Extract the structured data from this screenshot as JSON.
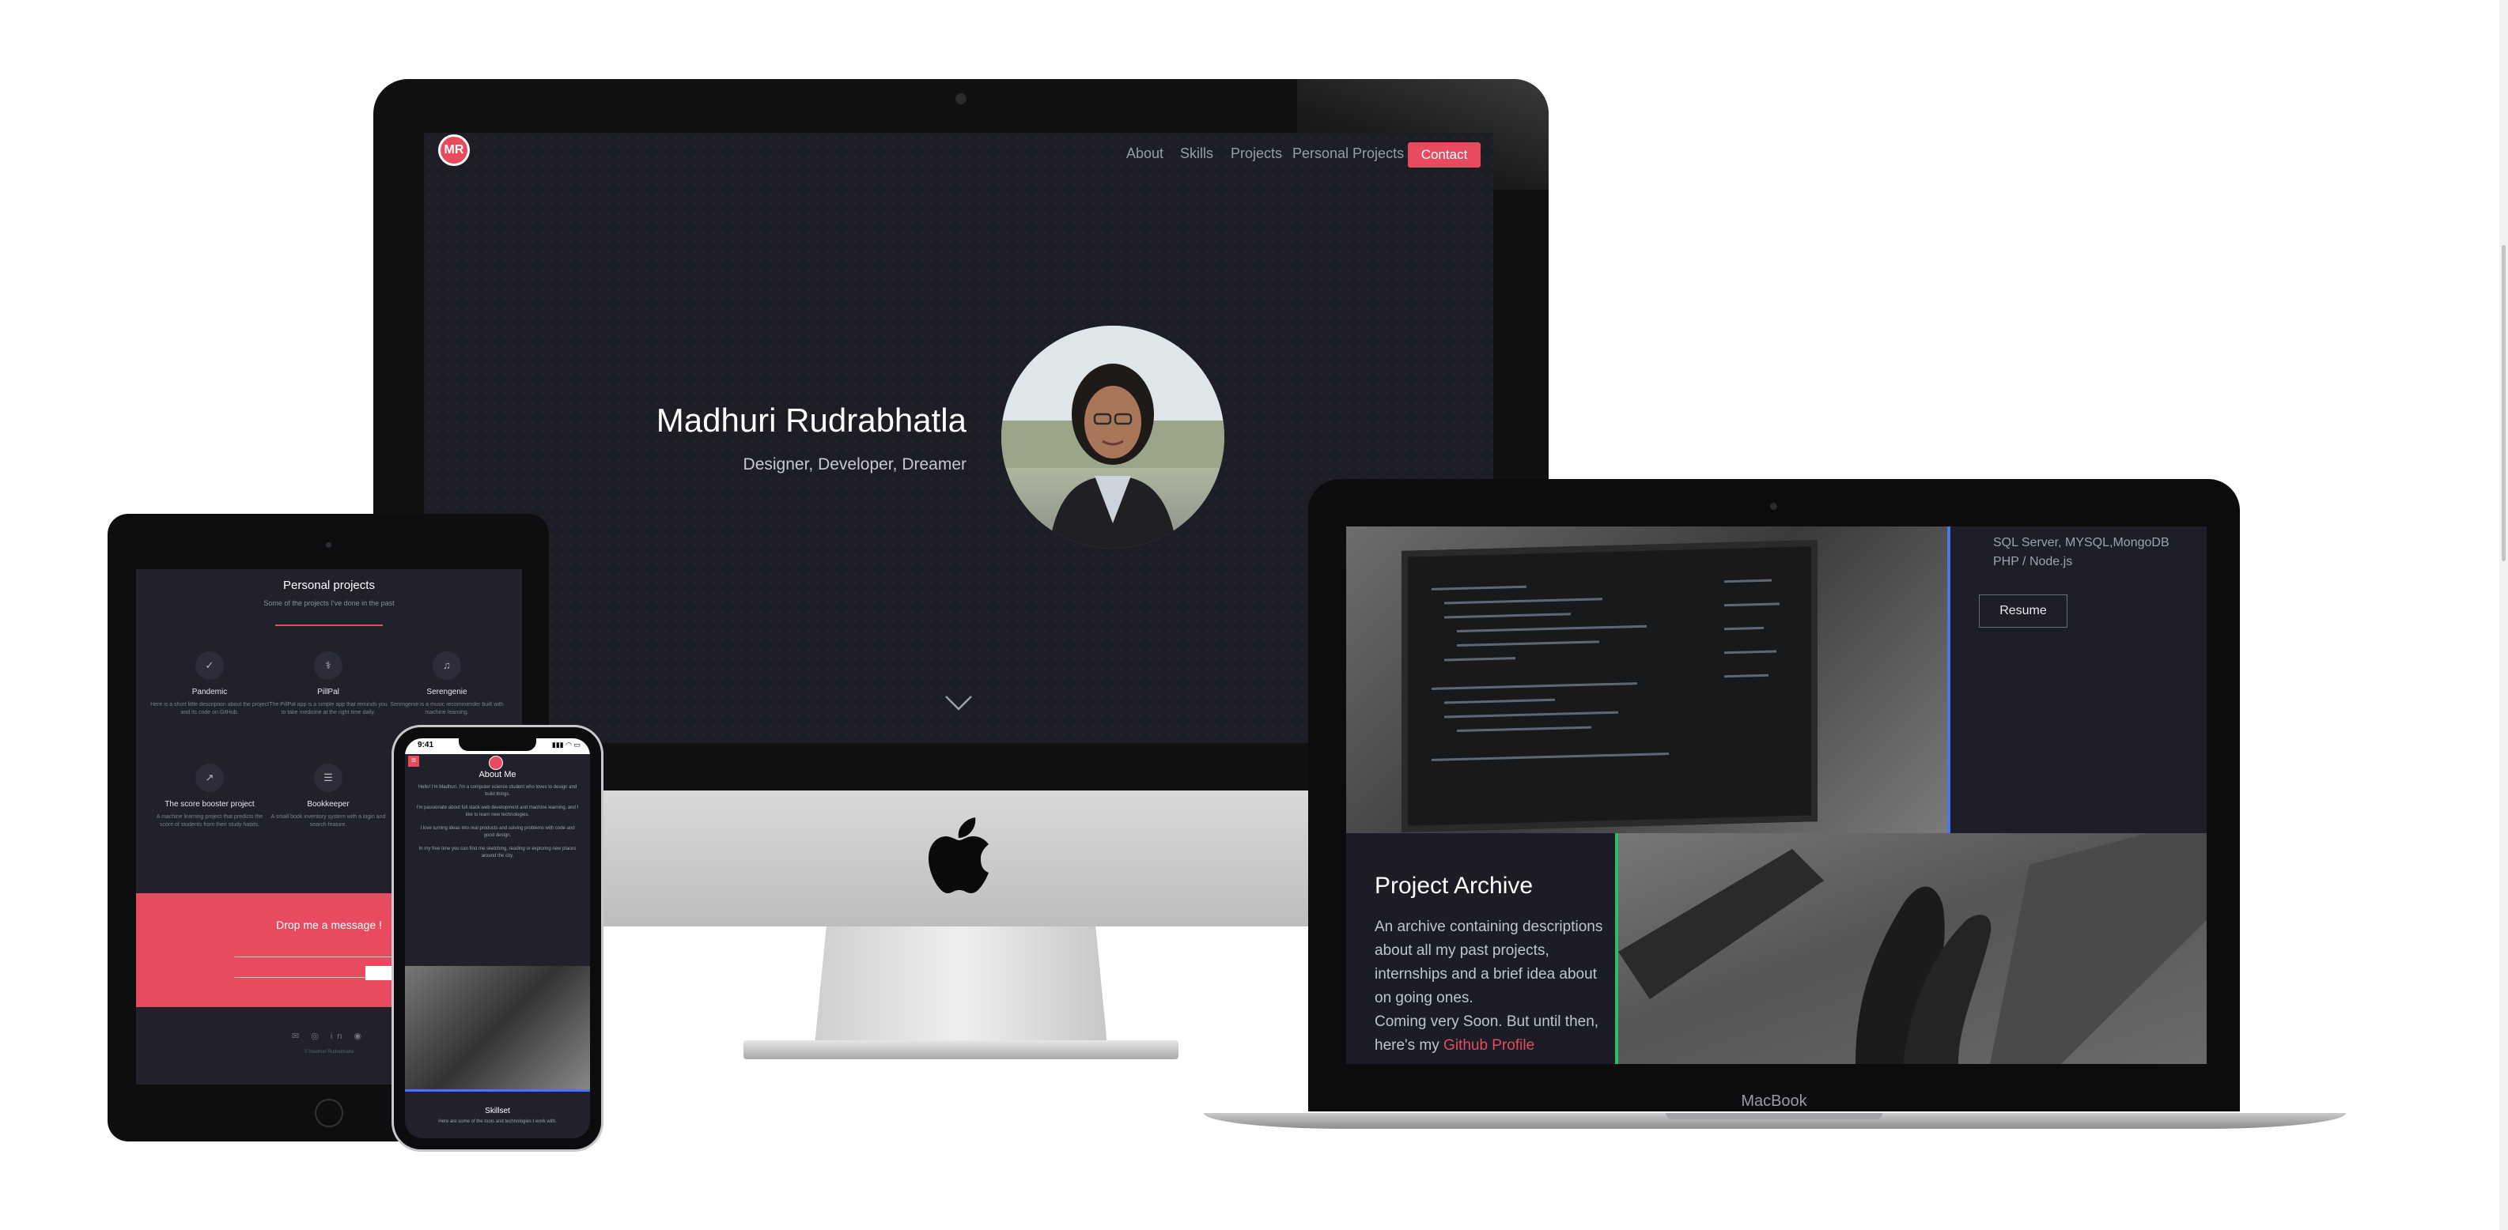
{
  "imac": {
    "logo_text": "MR",
    "nav": [
      "About",
      "Skills",
      "Projects",
      "Personal Projects"
    ],
    "contact_label": "Contact",
    "hero_name": "Madhuri Rudrabhatla",
    "hero_tagline": "Designer, Developer, Dreamer"
  },
  "macbook": {
    "label": "MacBook",
    "skills": [
      "SQL Server, MYSQL,MongoDB",
      "PHP / Node.js"
    ],
    "resume_label": "Resume",
    "archive_title": "Project Archive",
    "archive_text": "An archive containing descriptions about all my past projects, internships and a brief idea about on going ones.",
    "archive_soon": "Coming very Soon. But until then, here's my",
    "archive_link": "Github Profile"
  },
  "ipad": {
    "section_title": "Personal projects",
    "section_subtitle": "Some of the projects I've done in the past",
    "projects": [
      {
        "name": "Pandemic",
        "icon": "✓",
        "desc": "Here is a short little description about the project and its code on GitHub."
      },
      {
        "name": "PillPal",
        "icon": "⚕",
        "desc": "The PillPal app is a simple app that reminds you to take medicine at the right time daily."
      },
      {
        "name": "Serengenie",
        "icon": "♫",
        "desc": "Serengenie is a music recommender built with machine learning."
      },
      {
        "name": "The score booster project",
        "icon": "↗",
        "desc": "A machine learning project that predicts the score of students from their study habits."
      },
      {
        "name": "Bookkeeper",
        "icon": "☰",
        "desc": "A small book inventory system with a login and search feature."
      }
    ],
    "message_title": "Drop me a message !",
    "footer_icons": "✉ ◎ in ◉",
    "copyright": "© Madhuri Rudrabhatla"
  },
  "iphone": {
    "time": "9:41",
    "status_icons": "▮▮▮ ◠ ▭",
    "menu_icon": "≡",
    "about_title": "About Me",
    "about_paragraphs": [
      "Hello! I'm Madhuri. I'm a computer science student who loves to design and build things.",
      "I'm passionate about full stack web development and machine learning, and I like to learn new technologies.",
      "I love turning ideas into real products and solving problems with code and good design.",
      "In my free time you can find me sketching, reading or exploring new places around the city."
    ],
    "skillset_title": "Skillset",
    "skillset_text": "Here are some of the tools and technologies I work with."
  }
}
